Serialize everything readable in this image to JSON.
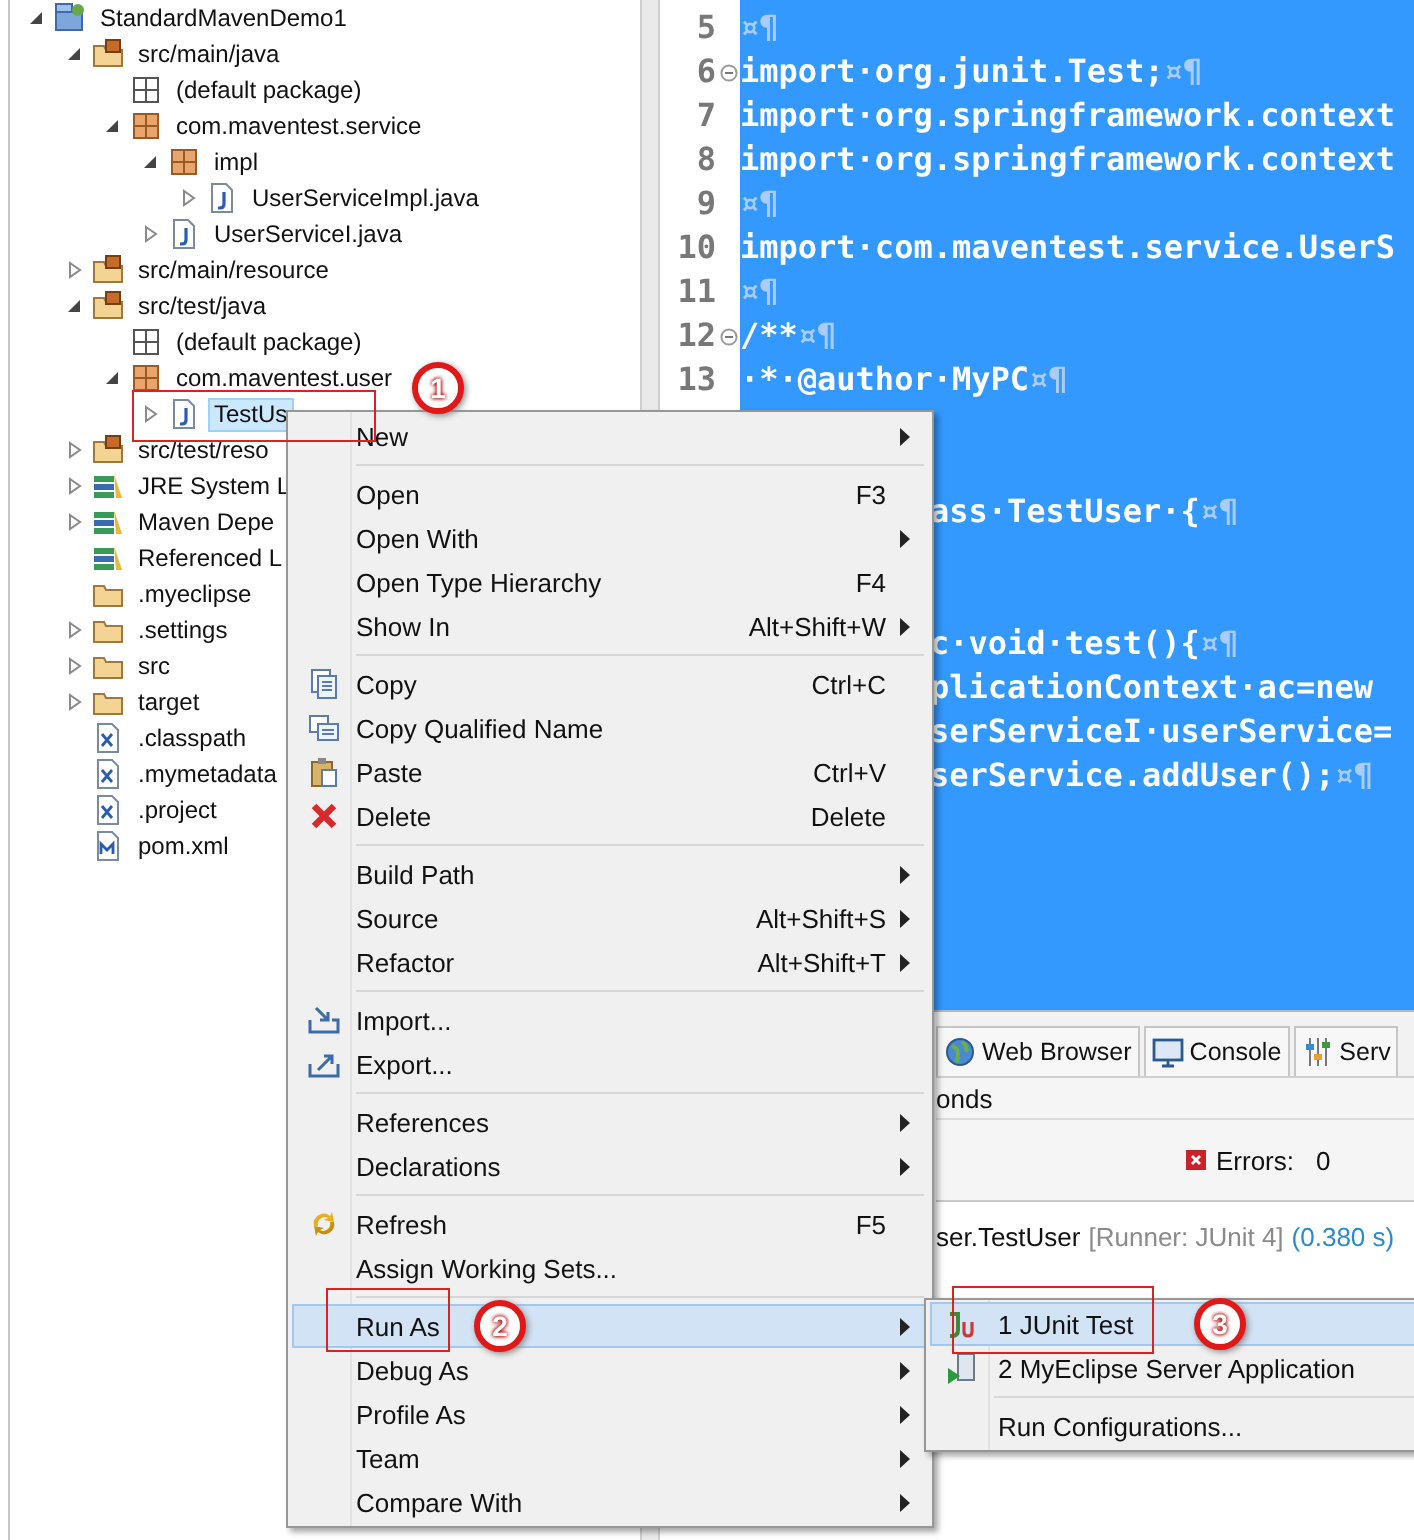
{
  "project_tree": {
    "items": [
      {
        "label": "StandardMavenDemo1",
        "kind": "project",
        "expandable": true,
        "expanded": true,
        "selected": false,
        "children": [
          {
            "label": "src/main/java",
            "kind": "source-folder",
            "expandable": true,
            "expanded": true,
            "selected": false,
            "children": [
              {
                "label": "(default package)",
                "kind": "empty-package",
                "expandable": false,
                "selected": false
              },
              {
                "label": "com.maventest.service",
                "kind": "package",
                "expandable": true,
                "expanded": true,
                "selected": false,
                "children": [
                  {
                    "label": "impl",
                    "kind": "package",
                    "expandable": true,
                    "expanded": true,
                    "selected": false,
                    "children": [
                      {
                        "label": "UserServiceImpl.java",
                        "kind": "java-file",
                        "expandable": true,
                        "expanded": false,
                        "selected": false
                      }
                    ]
                  },
                  {
                    "label": "UserServiceI.java",
                    "kind": "java-file",
                    "expandable": true,
                    "expanded": false,
                    "selected": false
                  }
                ]
              }
            ]
          },
          {
            "label": "src/main/resource",
            "kind": "source-folder",
            "expandable": true,
            "expanded": false,
            "selected": false
          },
          {
            "label": "src/test/java",
            "kind": "source-folder",
            "expandable": true,
            "expanded": true,
            "selected": false,
            "children": [
              {
                "label": "(default package)",
                "kind": "empty-package",
                "expandable": false,
                "selected": false
              },
              {
                "label": "com.maventest.user",
                "kind": "package",
                "expandable": true,
                "expanded": true,
                "selected": false,
                "children": [
                  {
                    "label": "TestUs",
                    "kind": "java-file",
                    "expandable": true,
                    "expanded": false,
                    "selected": true,
                    "callout": "1"
                  }
                ]
              }
            ]
          },
          {
            "label": "src/test/reso",
            "kind": "source-folder",
            "expandable": true,
            "expanded": false,
            "selected": false
          },
          {
            "label": "JRE System L",
            "kind": "library",
            "expandable": true,
            "expanded": false,
            "selected": false
          },
          {
            "label": "Maven Depe",
            "kind": "library",
            "expandable": true,
            "expanded": false,
            "selected": false
          },
          {
            "label": "Referenced L",
            "kind": "library",
            "expandable": false,
            "selected": false
          },
          {
            "label": ".myeclipse",
            "kind": "folder",
            "expandable": false,
            "selected": false
          },
          {
            "label": ".settings",
            "kind": "folder",
            "expandable": true,
            "expanded": false,
            "selected": false
          },
          {
            "label": "src",
            "kind": "folder",
            "expandable": true,
            "expanded": false,
            "selected": false
          },
          {
            "label": "target",
            "kind": "folder",
            "expandable": true,
            "expanded": false,
            "selected": false
          },
          {
            "label": ".classpath",
            "kind": "xml-file",
            "expandable": false,
            "selected": false
          },
          {
            "label": ".mymetadata",
            "kind": "xml-file",
            "expandable": false,
            "selected": false
          },
          {
            "label": ".project",
            "kind": "xml-file",
            "expandable": false,
            "selected": false
          },
          {
            "label": "pom.xml",
            "kind": "maven-file",
            "expandable": false,
            "selected": false
          }
        ]
      }
    ]
  },
  "editor": {
    "lines": [
      {
        "kind": "full",
        "number": "5",
        "eol": "¤¶",
        "fold": false
      },
      {
        "kind": "full",
        "number": "6",
        "text": "import·org.junit.Test;",
        "eol": "¤¶",
        "fold": true
      },
      {
        "kind": "full",
        "number": "7",
        "text": "import·org.springframework.context",
        "fold": false
      },
      {
        "kind": "full",
        "number": "8",
        "text": "import·org.springframework.context",
        "fold": false
      },
      {
        "kind": "full",
        "number": "9",
        "eol": "¤¶",
        "fold": false
      },
      {
        "kind": "full",
        "number": "10",
        "text": "import·com.maventest.service.UserS",
        "fold": false
      },
      {
        "kind": "full",
        "number": "11",
        "eol": "¤¶",
        "fold": false
      },
      {
        "kind": "full",
        "number": "12",
        "text": "/**",
        "eol": "¤¶",
        "fold": true
      },
      {
        "kind": "full",
        "number": "13",
        "text": "·*·@author·MyPC",
        "eol": "¤¶",
        "fold": false
      },
      {
        "kind": "hidden"
      },
      {
        "kind": "hidden"
      },
      {
        "kind": "partial",
        "text": "ass·TestUser·{",
        "eol": "¤¶"
      },
      {
        "kind": "hidden"
      },
      {
        "kind": "hidden"
      },
      {
        "kind": "partial",
        "text": "c·void·test(){",
        "eol": "¤¶"
      },
      {
        "kind": "partial",
        "text": "plicationContext·ac=new"
      },
      {
        "kind": "partial",
        "text": "serServiceI·userService="
      },
      {
        "kind": "partial",
        "text": "serService.addUser();",
        "eol": "¤¶"
      }
    ]
  },
  "bottom_panel": {
    "tabs": [
      {
        "label": "Web Browser",
        "kind": "globe"
      },
      {
        "label": "Console",
        "kind": "monitor"
      },
      {
        "label": "Serv",
        "kind": "servers"
      }
    ],
    "status": "onds",
    "errors_label": "Errors:",
    "errors_count": "0",
    "result": {
      "name": "ser.TestUser",
      "runner": "[Runner: JUnit 4]",
      "time": "(0.380 s)"
    }
  },
  "context_menu": {
    "items": [
      {
        "kind": "item",
        "label": "New",
        "submenu": true,
        "selected": false
      },
      {
        "kind": "separator"
      },
      {
        "kind": "item",
        "label": "Open",
        "shortcut": "F3",
        "submenu": false,
        "selected": false
      },
      {
        "kind": "item",
        "label": "Open With",
        "submenu": true,
        "selected": false
      },
      {
        "kind": "item",
        "label": "Open Type Hierarchy",
        "shortcut": "F4",
        "submenu": false,
        "selected": false
      },
      {
        "kind": "item",
        "label": "Show In",
        "shortcut": "Alt+Shift+W",
        "submenu": true,
        "selected": false
      },
      {
        "kind": "separator"
      },
      {
        "kind": "copy",
        "label": "Copy",
        "shortcut": "Ctrl+C",
        "submenu": false,
        "selected": false
      },
      {
        "kind": "copy-name",
        "label": "Copy Qualified Name",
        "submenu": false,
        "selected": false
      },
      {
        "kind": "paste",
        "label": "Paste",
        "shortcut": "Ctrl+V",
        "submenu": false,
        "selected": false
      },
      {
        "kind": "delete",
        "label": "Delete",
        "shortcut": "Delete",
        "submenu": false,
        "selected": false
      },
      {
        "kind": "separator"
      },
      {
        "kind": "item",
        "label": "Build Path",
        "submenu": true,
        "selected": false
      },
      {
        "kind": "item",
        "label": "Source",
        "shortcut": "Alt+Shift+S",
        "submenu": true,
        "selected": false
      },
      {
        "kind": "item",
        "label": "Refactor",
        "shortcut": "Alt+Shift+T",
        "submenu": true,
        "selected": false
      },
      {
        "kind": "separator"
      },
      {
        "kind": "import",
        "label": "Import...",
        "submenu": false,
        "selected": false
      },
      {
        "kind": "export",
        "label": "Export...",
        "submenu": false,
        "selected": false
      },
      {
        "kind": "separator"
      },
      {
        "kind": "item",
        "label": "References",
        "submenu": true,
        "selected": false
      },
      {
        "kind": "item",
        "label": "Declarations",
        "submenu": true,
        "selected": false
      },
      {
        "kind": "separator"
      },
      {
        "kind": "refresh",
        "label": "Refresh",
        "shortcut": "F5",
        "submenu": false,
        "selected": false
      },
      {
        "kind": "item",
        "label": "Assign Working Sets...",
        "submenu": false,
        "selected": false
      },
      {
        "kind": "separator"
      },
      {
        "kind": "item",
        "label": "Run As",
        "submenu": true,
        "selected": true,
        "callout": "2"
      },
      {
        "kind": "item",
        "label": "Debug As",
        "submenu": true,
        "selected": false
      },
      {
        "kind": "item",
        "label": "Profile As",
        "submenu": true,
        "selected": false
      },
      {
        "kind": "item",
        "label": "Team",
        "submenu": true,
        "selected": false
      },
      {
        "kind": "item",
        "label": "Compare With",
        "submenu": true,
        "selected": false
      }
    ]
  },
  "submenu": {
    "items": [
      {
        "kind": "junit",
        "label": "1 JUnit Test",
        "selected": true,
        "callout": "3"
      },
      {
        "kind": "server-run",
        "label": "2 MyEclipse Server Application",
        "selected": false
      },
      {
        "kind": "separator"
      },
      {
        "kind": "item",
        "label": "Run Configurations...",
        "selected": false
      }
    ]
  }
}
